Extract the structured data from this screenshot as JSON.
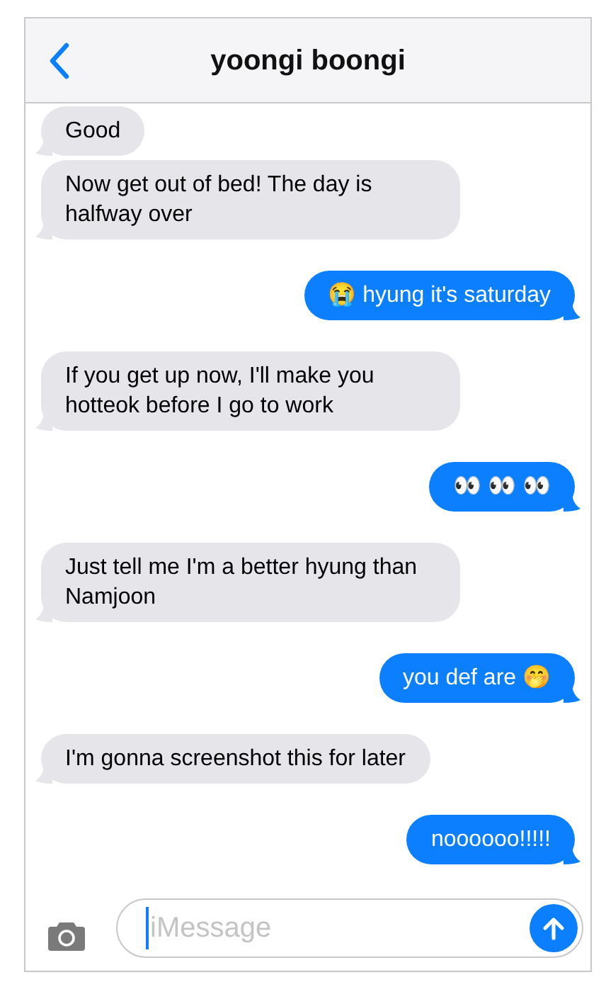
{
  "header": {
    "title": "yoongi boongi"
  },
  "messages": [
    {
      "kind": "received",
      "text": "Good"
    },
    {
      "kind": "received",
      "text": "Now get out of bed! The day is halfway over"
    },
    {
      "kind": "sent",
      "text": "😭 hyung it's saturday"
    },
    {
      "kind": "received",
      "text": "If you get up now, I'll make you hotteok before I go to work"
    },
    {
      "kind": "sent",
      "text": "👀 👀 👀"
    },
    {
      "kind": "received",
      "text": "Just tell me I'm a better hyung than Namjoon"
    },
    {
      "kind": "sent",
      "text": "you def are 🤭"
    },
    {
      "kind": "received",
      "text": "I'm gonna screenshot this for later"
    },
    {
      "kind": "sent",
      "text": "noooooo!!!!!"
    }
  ],
  "composer": {
    "placeholder": "iMessage"
  }
}
